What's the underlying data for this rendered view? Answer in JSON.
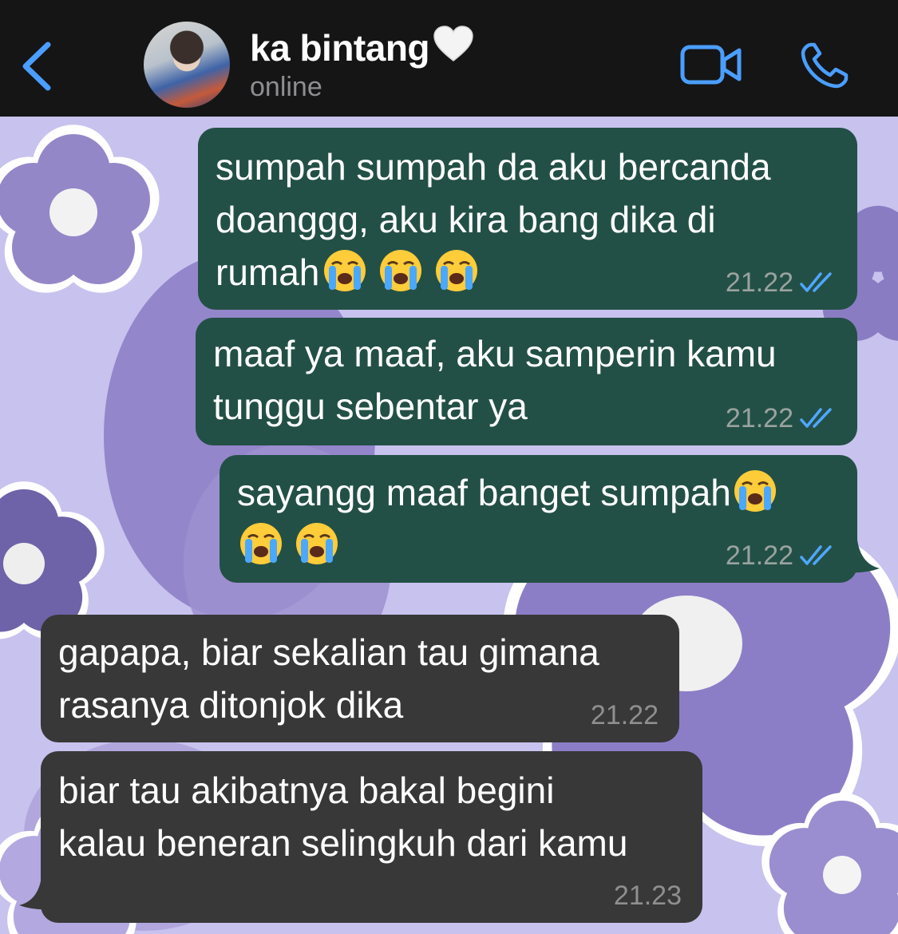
{
  "header": {
    "contact_name": "ka bintang",
    "status": "online",
    "colors": {
      "background": "#151515",
      "accent": "#4a9eff"
    }
  },
  "wallpaper": {
    "colors": {
      "base": "#c8c2ee",
      "flower": "#8e7fc9",
      "flower_dark": "#6f63aa"
    }
  },
  "messages": [
    {
      "direction": "outgoing",
      "lines": [
        "sumpah sumpah da aku bercanda",
        "doanggg, aku kira bang dika di",
        "rumah"
      ],
      "emoji": [
        "loudly-crying-face",
        "loudly-crying-face",
        "loudly-crying-face"
      ],
      "time": "21.22",
      "status": "read"
    },
    {
      "direction": "outgoing",
      "lines": [
        "maaf ya maaf, aku samperin kamu",
        "tunggu sebentar ya"
      ],
      "time": "21.22",
      "status": "read"
    },
    {
      "direction": "outgoing",
      "lines": [
        "sayangg maaf banget sumpah"
      ],
      "emoji": [
        "loudly-crying-face",
        "loudly-crying-face",
        "loudly-crying-face"
      ],
      "time": "21.22",
      "status": "read"
    },
    {
      "direction": "incoming",
      "lines": [
        "gapapa, biar sekalian tau gimana",
        "rasanya ditonjok dika"
      ],
      "time": "21.22"
    },
    {
      "direction": "incoming",
      "lines": [
        "biar tau akibatnya bakal begini",
        "kalau beneran selingkuh dari kamu"
      ],
      "time": "21.23"
    }
  ],
  "colors": {
    "outgoing_bubble": "#235046",
    "incoming_bubble": "#383838",
    "read_ticks": "#4fa7ff"
  }
}
